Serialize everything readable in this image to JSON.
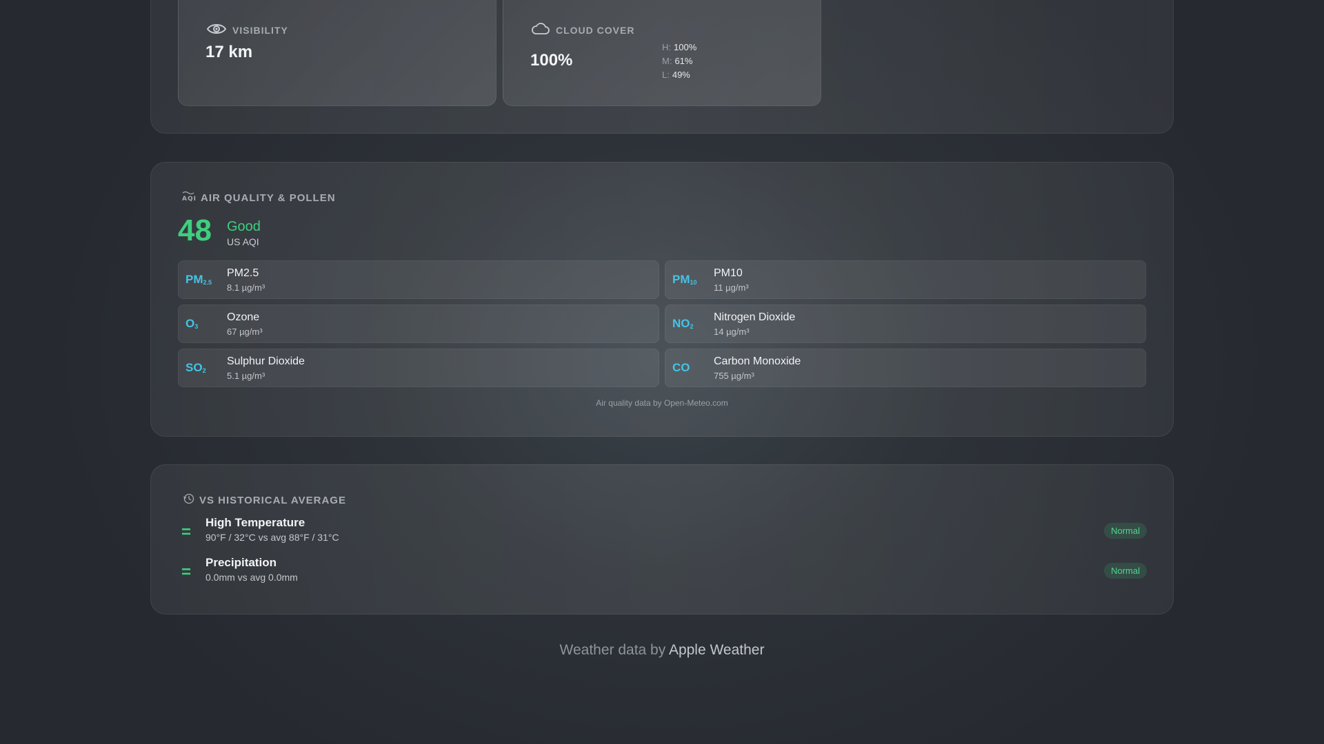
{
  "visibility": {
    "label": "VISIBILITY",
    "value": "17 km",
    "icon": "eye-icon"
  },
  "cloud_cover": {
    "label": "CLOUD COVER",
    "value": "100%",
    "icon": "cloud-icon",
    "levels": [
      {
        "key": "H:",
        "value": "100%"
      },
      {
        "key": "M:",
        "value": "61%"
      },
      {
        "key": "L:",
        "value": "49%"
      }
    ]
  },
  "air_quality": {
    "header": "AIR QUALITY & POLLEN",
    "icon": "aqi-icon",
    "aqi_value": "48",
    "aqi_status": "Good",
    "aqi_scale": "US AQI",
    "pollutants": [
      {
        "symbol": "PM",
        "sub": "2.5",
        "name": "PM2.5",
        "value": "8.1 µg/m³"
      },
      {
        "symbol": "PM",
        "sub": "10",
        "name": "PM10",
        "value": "11 µg/m³"
      },
      {
        "symbol": "O",
        "sub": "3",
        "name": "Ozone",
        "value": "67 µg/m³"
      },
      {
        "symbol": "NO",
        "sub": "2",
        "name": "Nitrogen Dioxide",
        "value": "14 µg/m³"
      },
      {
        "symbol": "SO",
        "sub": "2",
        "name": "Sulphur Dioxide",
        "value": "5.1 µg/m³"
      },
      {
        "symbol": "CO",
        "sub": "",
        "name": "Carbon Monoxide",
        "value": "755 µg/m³"
      }
    ],
    "attribution": "Air quality data by Open-Meteo.com"
  },
  "historical": {
    "header": "VS HISTORICAL AVERAGE",
    "icon": "history-icon",
    "rows": [
      {
        "indicator": "=",
        "title": "High Temperature",
        "detail": "90°F / 32°C vs avg 88°F / 31°C",
        "badge": "Normal"
      },
      {
        "indicator": "=",
        "title": "Precipitation",
        "detail": "0.0mm vs avg 0.0mm",
        "badge": "Normal"
      }
    ]
  },
  "footer": {
    "prefix": "Weather data by",
    "brand": "Apple Weather"
  },
  "colors": {
    "good": "#3ecf7e",
    "pollutant_symbol": "#45c3e6",
    "background": "#25292f"
  }
}
